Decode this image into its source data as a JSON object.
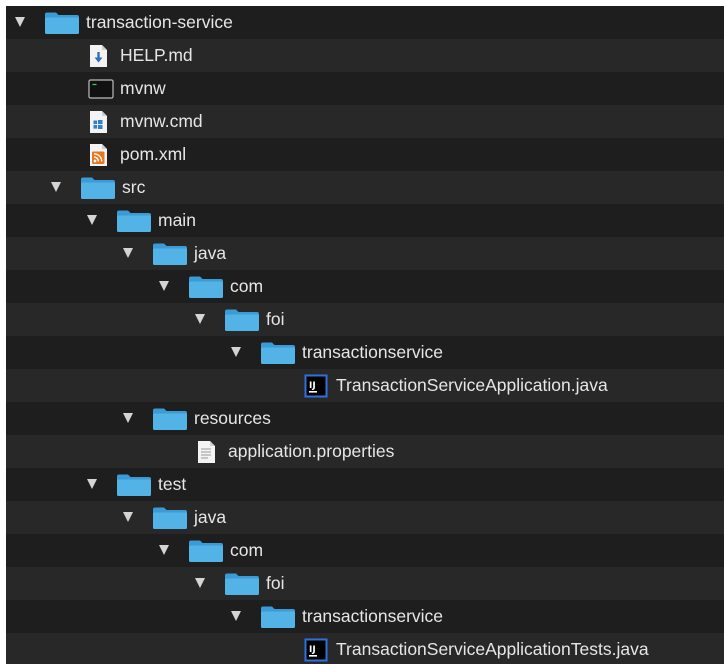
{
  "tree": {
    "items": [
      {
        "label": "transaction-service",
        "kind": "folder",
        "expanded": true,
        "depth": 0,
        "icon": "folder-icon"
      },
      {
        "label": "HELP.md",
        "kind": "file",
        "depth": 1,
        "icon": "markdown-file-icon"
      },
      {
        "label": "mvnw",
        "kind": "file",
        "depth": 1,
        "icon": "terminal-file-icon"
      },
      {
        "label": "mvnw.cmd",
        "kind": "file",
        "depth": 1,
        "icon": "windows-cmd-file-icon"
      },
      {
        "label": "pom.xml",
        "kind": "file",
        "depth": 1,
        "icon": "xml-feed-file-icon"
      },
      {
        "label": "src",
        "kind": "folder",
        "expanded": true,
        "depth": 1,
        "icon": "folder-icon"
      },
      {
        "label": "main",
        "kind": "folder",
        "expanded": true,
        "depth": 2,
        "icon": "folder-icon"
      },
      {
        "label": "java",
        "kind": "folder",
        "expanded": true,
        "depth": 3,
        "icon": "folder-icon"
      },
      {
        "label": "com",
        "kind": "folder",
        "expanded": true,
        "depth": 4,
        "icon": "folder-icon"
      },
      {
        "label": "foi",
        "kind": "folder",
        "expanded": true,
        "depth": 5,
        "icon": "folder-icon"
      },
      {
        "label": "transactionservice",
        "kind": "folder",
        "expanded": true,
        "depth": 6,
        "icon": "folder-icon"
      },
      {
        "label": "TransactionServiceApplication.java",
        "kind": "file",
        "depth": 7,
        "icon": "intellij-java-file-icon"
      },
      {
        "label": "resources",
        "kind": "folder",
        "expanded": true,
        "depth": 3,
        "icon": "folder-icon"
      },
      {
        "label": "application.properties",
        "kind": "file",
        "depth": 4,
        "icon": "text-document-icon"
      },
      {
        "label": "test",
        "kind": "folder",
        "expanded": true,
        "depth": 2,
        "icon": "folder-icon"
      },
      {
        "label": "java",
        "kind": "folder",
        "expanded": true,
        "depth": 3,
        "icon": "folder-icon"
      },
      {
        "label": "com",
        "kind": "folder",
        "expanded": true,
        "depth": 4,
        "icon": "folder-icon"
      },
      {
        "label": "foi",
        "kind": "folder",
        "expanded": true,
        "depth": 5,
        "icon": "folder-icon"
      },
      {
        "label": "transactionservice",
        "kind": "folder",
        "expanded": true,
        "depth": 6,
        "icon": "folder-icon"
      },
      {
        "label": "TransactionServiceApplicationTests.java",
        "kind": "file",
        "depth": 7,
        "icon": "intellij-java-file-icon"
      }
    ]
  },
  "colors": {
    "panel_background": "#1e1e1e",
    "row_alternate": "#282828",
    "folder_blue": "#4fb0e3",
    "text": "#e6e6e6"
  }
}
